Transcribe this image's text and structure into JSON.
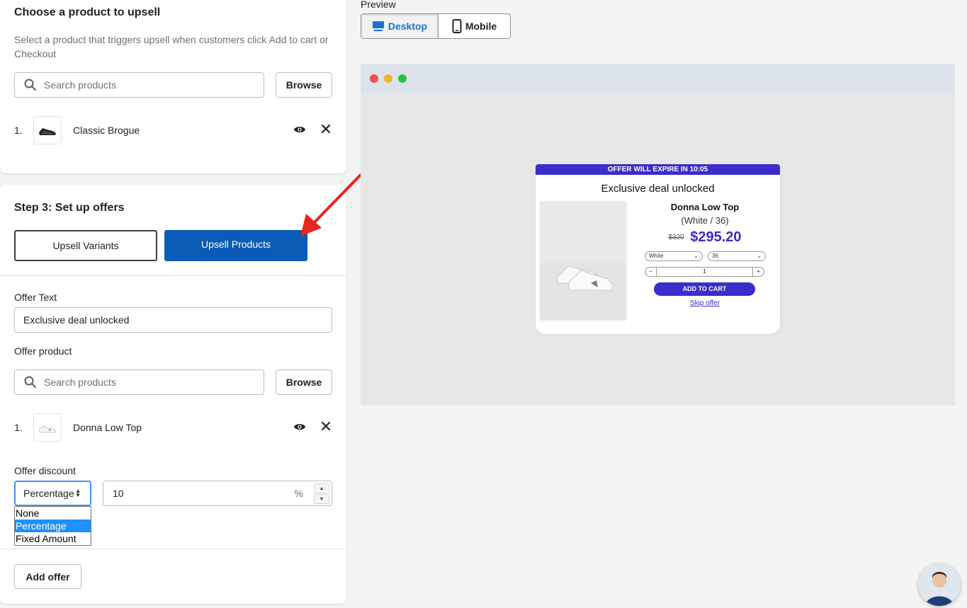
{
  "section1": {
    "title": "Choose a product to upsell",
    "description": "Select a product that triggers upsell when customers click Add to cart or Checkout",
    "search_placeholder": "Search products",
    "browse_label": "Browse",
    "products": [
      {
        "index": "1.",
        "name": "Classic Brogue"
      }
    ]
  },
  "section2": {
    "title": "Step 3: Set up offers",
    "tabs": {
      "variants": "Upsell Variants",
      "products": "Upsell Products"
    },
    "offer_text_label": "Offer Text",
    "offer_text_value": "Exclusive deal unlocked",
    "offer_product_label": "Offer product",
    "search_placeholder": "Search products",
    "browse_label": "Browse",
    "products": [
      {
        "index": "1.",
        "name": "Donna Low Top"
      }
    ],
    "discount_label": "Offer discount",
    "discount_type": "Percentage",
    "discount_value": "10",
    "discount_unit": "%",
    "discount_options": [
      "None",
      "Percentage",
      "Fixed Amount"
    ],
    "add_offer_label": "Add offer"
  },
  "preview": {
    "label": "Preview",
    "desktop_label": "Desktop",
    "mobile_label": "Mobile",
    "popup": {
      "timer": "OFFER WILL EXPIRE IN 10:05",
      "title": "Exclusive deal unlocked",
      "product_name": "Donna Low Top",
      "variant": "(White / 36)",
      "old_price": "$320",
      "new_price": "$295.20",
      "color_option": "White",
      "size_option": "36",
      "quantity": "1",
      "qty_minus": "−",
      "qty_plus": "+",
      "add_to_cart": "ADD TO CART",
      "skip": "Skip offer"
    }
  },
  "colors": {
    "primary": "#0a5bb5",
    "accent": "#3b2ccc",
    "arrow": "#e8251f"
  }
}
